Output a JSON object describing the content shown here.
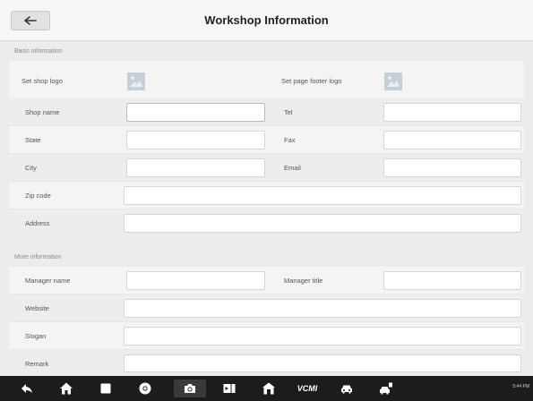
{
  "header": {
    "title": "Workshop Information",
    "back_icon": "back-arrow-icon"
  },
  "sections": {
    "basic": {
      "heading": "Basic information"
    },
    "more": {
      "heading": "More information"
    }
  },
  "basic_rows": {
    "shop_logo_label": "Set shop logo",
    "footer_logo_label": "Set page footer logo",
    "shop_name_label": "Shop name",
    "tel_label": "Tel",
    "state_label": "State",
    "fax_label": "Fax",
    "city_label": "City",
    "email_label": "Email",
    "zip_label": "Zip code",
    "address_label": "Address"
  },
  "more_rows": {
    "manager_name_label": "Manager name",
    "manager_title_label": "Manager title",
    "website_label": "Website",
    "slogan_label": "Slogan",
    "remark_label": "Remark"
  },
  "navbar": {
    "vci_label": "VCMI",
    "status": "5:44 PM"
  }
}
